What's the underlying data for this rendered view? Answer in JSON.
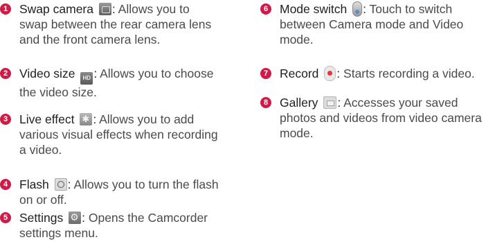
{
  "left_items": [
    {
      "number": "1",
      "term": "Swap camera",
      "icon": "swap-camera-icon",
      "colon": ":",
      "desc_lines": [
        " Allows you to",
        "swap between the rear camera lens",
        "and the front camera lens."
      ]
    },
    {
      "number": "2",
      "term": "Video size",
      "icon": "hd-video-size-icon",
      "icon_text": "HD",
      "colon": ":",
      "desc_lines": [
        " Allows you to choose",
        "the video size."
      ]
    },
    {
      "number": "3",
      "term": "Live effect",
      "icon": "live-effect-icon",
      "colon": ":",
      "desc_lines": [
        " Allows you to add",
        "various visual effects when recording",
        "a video."
      ]
    },
    {
      "number": "4",
      "term": "Flash",
      "icon": "flash-icon",
      "colon": ":",
      "desc_lines": [
        " Allows you to turn the flash",
        "on or off."
      ]
    },
    {
      "number": "5",
      "term": "Settings",
      "icon": "settings-gear-icon",
      "colon": ":",
      "desc_lines": [
        " Opens the Camcorder",
        "settings menu."
      ]
    }
  ],
  "right_items": [
    {
      "number": "6",
      "term": "Mode switch",
      "icon": "mode-switch-icon",
      "colon": ":",
      "desc_lines": [
        " Touch to switch",
        "between Camera mode and Video",
        "mode."
      ]
    },
    {
      "number": "7",
      "term": "Record",
      "icon": "record-icon",
      "colon": ":",
      "desc_lines": [
        " Starts recording a video."
      ]
    },
    {
      "number": "8",
      "term": "Gallery",
      "icon": "gallery-icon",
      "colon": ":",
      "desc_lines": [
        " Accesses your saved",
        "photos and videos from video camera",
        "mode."
      ]
    }
  ],
  "colors": {
    "number_badge": "#d21a48",
    "body_text": "#4a4a4a",
    "term_text": "#1f1f1f"
  }
}
